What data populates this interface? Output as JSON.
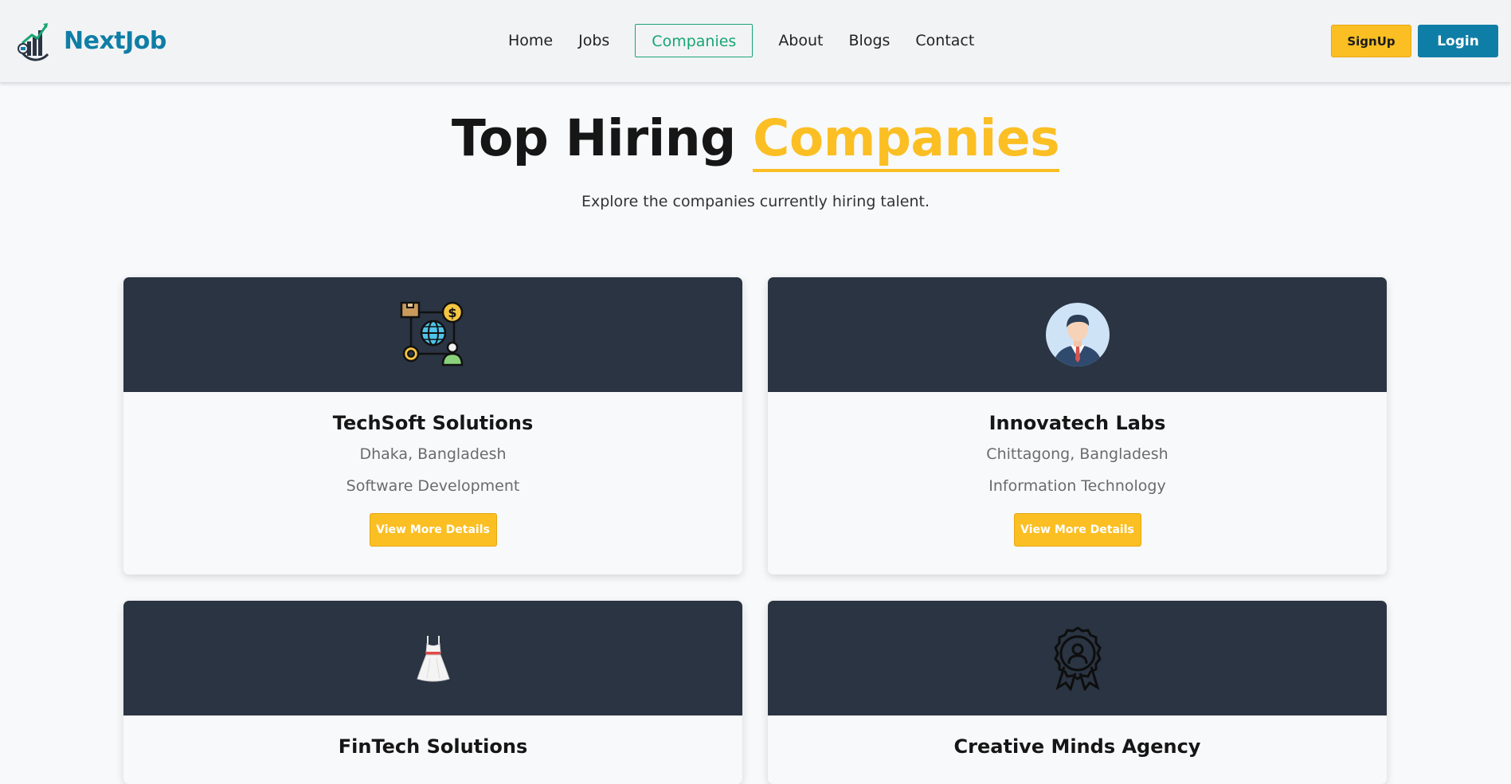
{
  "brand": {
    "name": "NextJob",
    "logo_icon": "growth-chart-logo-icon"
  },
  "nav": {
    "items": [
      {
        "label": "Home",
        "active": false
      },
      {
        "label": "Jobs",
        "active": false
      },
      {
        "label": "Companies",
        "active": true
      },
      {
        "label": "About",
        "active": false
      },
      {
        "label": "Blogs",
        "active": false
      },
      {
        "label": "Contact",
        "active": false
      }
    ]
  },
  "auth": {
    "signup_label": "SignUp",
    "login_label": "Login"
  },
  "hero": {
    "title_part1": "Top Hiring ",
    "title_accent": "Companies",
    "subtitle": "Explore the companies currently hiring talent."
  },
  "companies": [
    {
      "name": "TechSoft Solutions",
      "location": "Dhaka, Bangladesh",
      "industry": "Software Development",
      "button": "View More Details",
      "icon": "global-network-icon"
    },
    {
      "name": "Innovatech Labs",
      "location": "Chittagong, Bangladesh",
      "industry": "Information Technology",
      "button": "View More Details",
      "icon": "businessman-avatar-icon"
    },
    {
      "name": "FinTech Solutions",
      "location": "",
      "industry": "",
      "button": "",
      "icon": "dress-icon"
    },
    {
      "name": "Creative Minds Agency",
      "location": "",
      "industry": "",
      "button": "",
      "icon": "award-badge-icon"
    }
  ],
  "colors": {
    "brand": "#0f7ea6",
    "accent": "#fbbf24",
    "active_nav": "#17a673",
    "card_header": "#2a3442"
  }
}
